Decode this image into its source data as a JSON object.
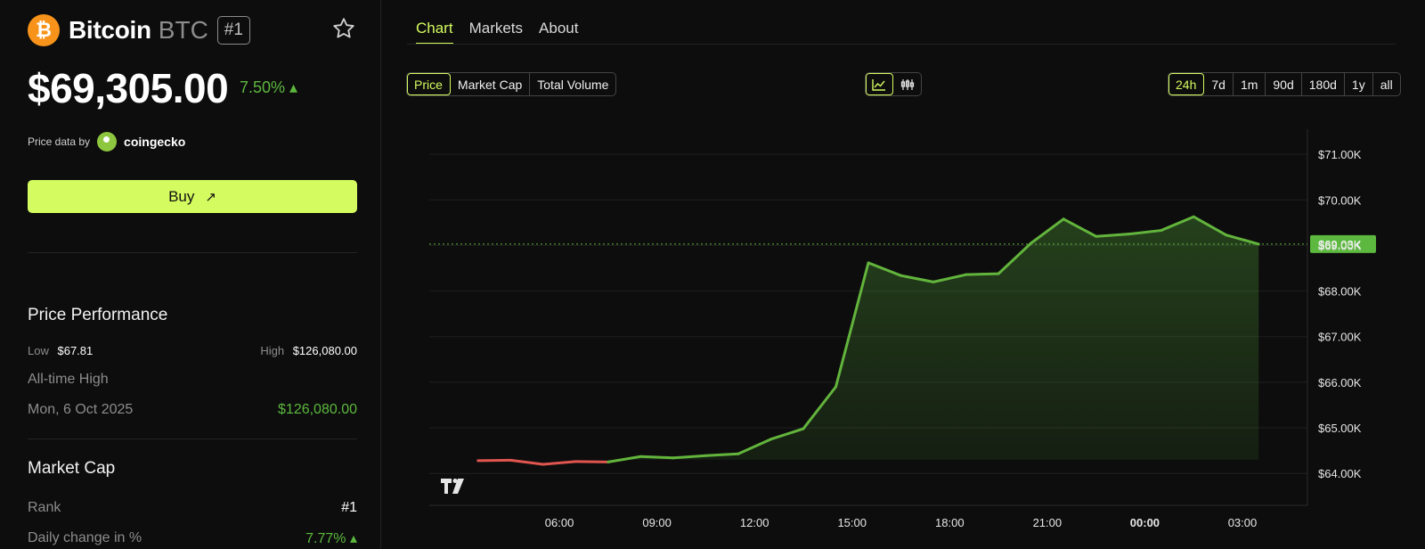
{
  "coin": {
    "logo_glyph": "₿",
    "name": "Bitcoin",
    "symbol": "BTC",
    "rank_badge": "#1",
    "price": "$69,305.00",
    "change": "7.50% ▴",
    "price_data_label": "Price data by",
    "provider": "coingecko"
  },
  "buy_label": "Buy",
  "buy_icon": "arrow-up-right-icon",
  "performance": {
    "title": "Price Performance",
    "low_label": "Low",
    "low_value": "$67.81",
    "high_label": "High",
    "high_value": "$126,080.00",
    "ath_label": "All-time High",
    "ath_date": "Mon, 6 Oct 2025",
    "ath_value": "$126,080.00"
  },
  "market_cap": {
    "title": "Market Cap",
    "rank_label": "Rank",
    "rank_value": "#1",
    "daily_label": "Daily change in %",
    "daily_value": "7.77% ▴"
  },
  "tabs": [
    "Chart",
    "Markets",
    "About"
  ],
  "metric_toggle": [
    "Price",
    "Market Cap",
    "Total Volume"
  ],
  "chart_style_icons": [
    "line-chart-icon",
    "candlestick-icon"
  ],
  "ranges": [
    "24h",
    "7d",
    "1m",
    "90d",
    "180d",
    "1y",
    "all"
  ],
  "colors": {
    "accent": "#d4fb5f",
    "up": "#5cb83e",
    "down": "#e0554f",
    "line": "#62b43c"
  },
  "chart_data": {
    "type": "area",
    "x_ticks": [
      "06:00",
      "09:00",
      "12:00",
      "15:00",
      "18:00",
      "21:00",
      "00:00",
      "03:00"
    ],
    "y_ticks": [
      "$71.00K",
      "$70.00K",
      "$69.00K",
      "$68.00K",
      "$67.00K",
      "$66.00K",
      "$65.00K",
      "$64.00K"
    ],
    "ylim": [
      63.3,
      71.55
    ],
    "x_hours": [
      3.5,
      4.5,
      5.5,
      6.5,
      7.5,
      8.5,
      9.5,
      10.5,
      11.5,
      12.5,
      13.5,
      14.5,
      15.5,
      16.5,
      17.5,
      18.5,
      19.5,
      20.5,
      21.5,
      22.5,
      23.5,
      24.5,
      25.5,
      26.5,
      27.5
    ],
    "values_k": [
      64.28,
      64.29,
      64.2,
      64.26,
      64.25,
      64.37,
      64.34,
      64.39,
      64.43,
      64.75,
      64.98,
      65.9,
      68.62,
      68.34,
      68.2,
      68.36,
      68.38,
      69.05,
      69.58,
      69.2,
      69.25,
      69.33,
      69.63,
      69.23,
      69.03
    ],
    "down_segments": [
      [
        0,
        4
      ]
    ],
    "current_label": "$69.03K",
    "current_value_k": 69.03,
    "grid": true
  }
}
